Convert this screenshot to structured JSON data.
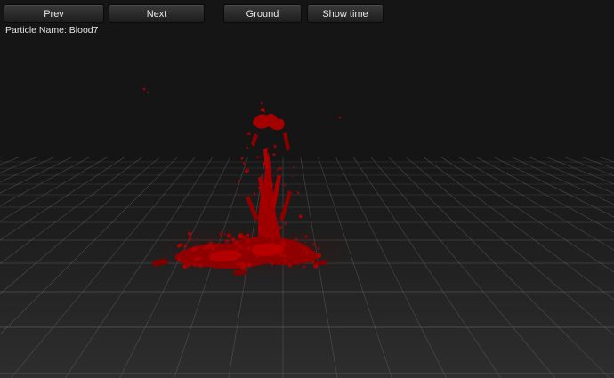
{
  "toolbar": {
    "prev_label": "Prev",
    "next_label": "Next",
    "ground_label": "Ground",
    "show_time_label": "Show time"
  },
  "info": {
    "particle_label": "Particle Name:",
    "particle_name": "Blood7"
  },
  "colors": {
    "background": "#151515",
    "floor_line": "#6a6a6a",
    "particle": "#b00000"
  }
}
